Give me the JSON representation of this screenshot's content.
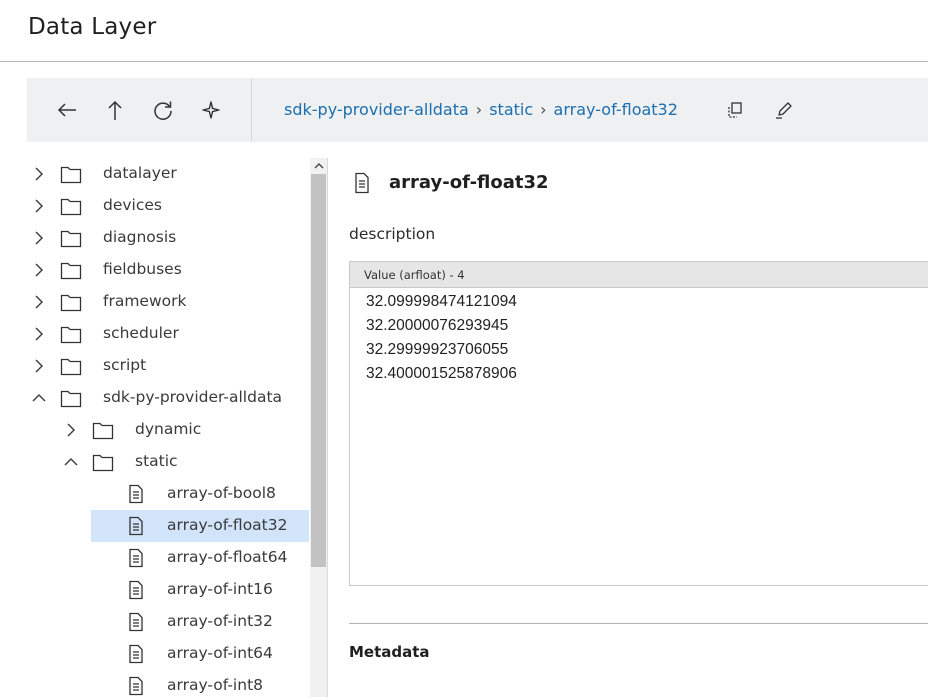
{
  "app": {
    "title": "Data Layer"
  },
  "toolbar": {
    "buttons": [
      {
        "name": "back",
        "icon": "arrow-left-icon"
      },
      {
        "name": "up",
        "icon": "arrow-up-icon"
      },
      {
        "name": "refresh",
        "icon": "refresh-icon"
      },
      {
        "name": "favorite",
        "icon": "sparkle-star-icon"
      }
    ],
    "breadcrumb": [
      "sdk-py-provider-alldata",
      "static",
      "array-of-float32"
    ],
    "actions": [
      {
        "name": "copy",
        "icon": "copy-icon"
      },
      {
        "name": "edit",
        "icon": "pencil-icon"
      }
    ]
  },
  "tree": {
    "items": [
      {
        "label": "datalayer",
        "type": "folder",
        "expanded": false
      },
      {
        "label": "devices",
        "type": "folder",
        "expanded": false
      },
      {
        "label": "diagnosis",
        "type": "folder",
        "expanded": false
      },
      {
        "label": "fieldbuses",
        "type": "folder",
        "expanded": false
      },
      {
        "label": "framework",
        "type": "folder",
        "expanded": false
      },
      {
        "label": "scheduler",
        "type": "folder",
        "expanded": false
      },
      {
        "label": "script",
        "type": "folder",
        "expanded": false
      },
      {
        "label": "sdk-py-provider-alldata",
        "type": "folder",
        "expanded": true
      },
      {
        "label": "dynamic",
        "type": "folder",
        "expanded": false
      },
      {
        "label": "static",
        "type": "folder",
        "expanded": true
      },
      {
        "label": "array-of-bool8",
        "type": "file"
      },
      {
        "label": "array-of-float32",
        "type": "file",
        "selected": true
      },
      {
        "label": "array-of-float64",
        "type": "file"
      },
      {
        "label": "array-of-int16",
        "type": "file"
      },
      {
        "label": "array-of-int32",
        "type": "file"
      },
      {
        "label": "array-of-int64",
        "type": "file"
      },
      {
        "label": "array-of-int8",
        "type": "file"
      }
    ]
  },
  "detail": {
    "title": "array-of-float32",
    "description_label": "description",
    "value_header": "Value (arfloat) - 4",
    "values": [
      "32.099998474121094",
      "32.20000076293945",
      "32.29999923706055",
      "32.400001525878906"
    ],
    "metadata_label": "Metadata"
  },
  "colors": {
    "accent": "#1c6fb0",
    "selection": "#d1e4fa",
    "toolbar_bg": "#eff0f1"
  }
}
